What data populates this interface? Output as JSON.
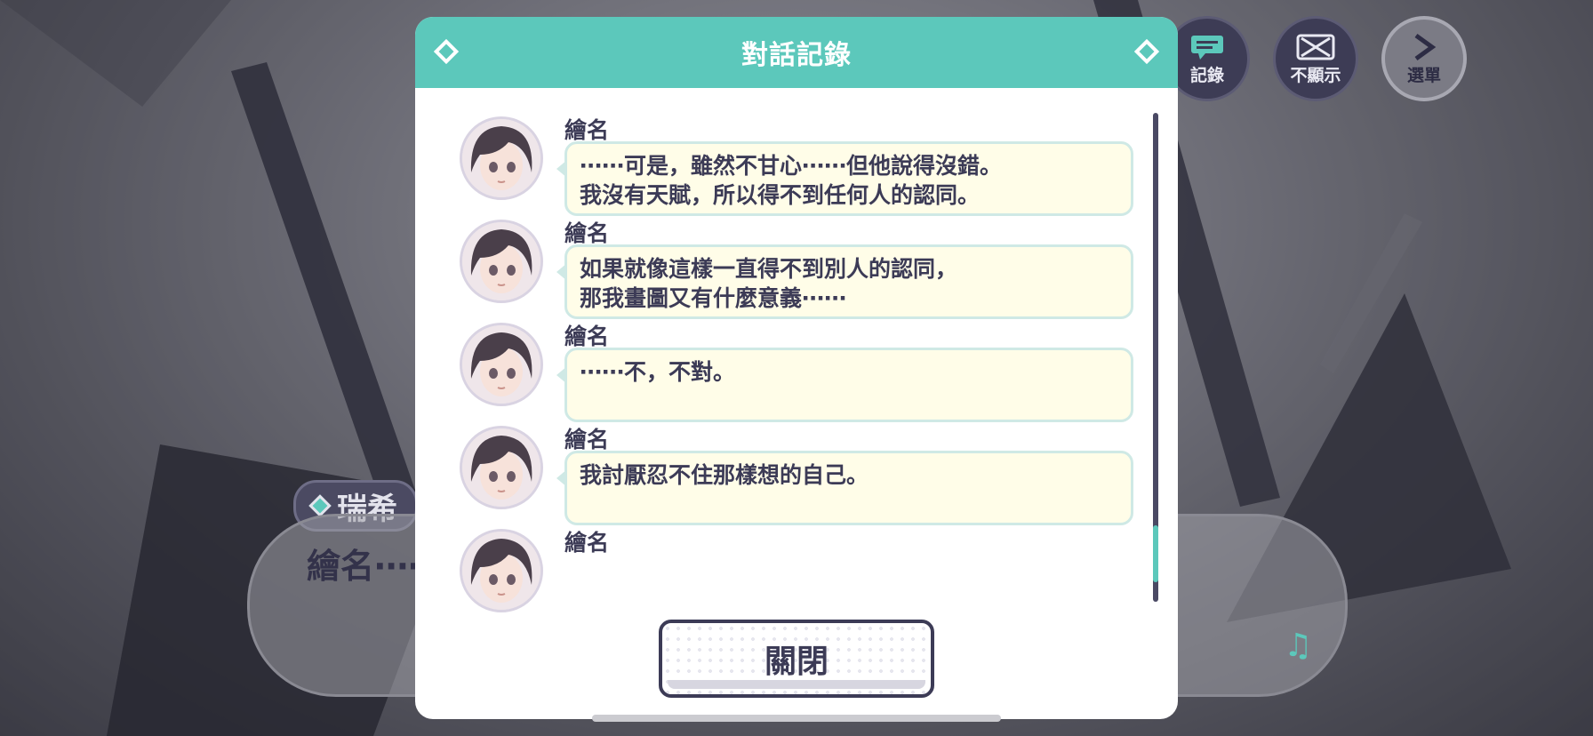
{
  "top_buttons": {
    "log_label": "記錄",
    "hide_label": "不顯示",
    "menu_label": "選單"
  },
  "background_dialog": {
    "speaker": "瑞希",
    "text": "繪名⋯⋯"
  },
  "modal": {
    "title": "對話記錄",
    "entries": [
      {
        "speaker": "繪名",
        "lines": [
          "⋯⋯可是，雖然不甘心⋯⋯但他說得沒錯。",
          "我沒有天賦，所以得不到任何人的認同。"
        ]
      },
      {
        "speaker": "繪名",
        "lines": [
          "如果就像這樣一直得不到別人的認同，",
          "那我畫圖又有什麼意義⋯⋯"
        ]
      },
      {
        "speaker": "繪名",
        "lines": [
          "⋯⋯不，不對。"
        ]
      },
      {
        "speaker": "繪名",
        "lines": [
          "我討厭忍不住那樣想的自己。"
        ]
      },
      {
        "speaker": "繪名"
      }
    ],
    "close_label": "關閉"
  },
  "scroll_position": 0.9,
  "colors": {
    "accent": "#5cc8bb",
    "text": "#3c3b56",
    "bubble": "#fffde8"
  },
  "icons": [
    "log-icon",
    "hide-icon",
    "menu-chevron-icon",
    "diamond-icon",
    "music-note-icon"
  ]
}
